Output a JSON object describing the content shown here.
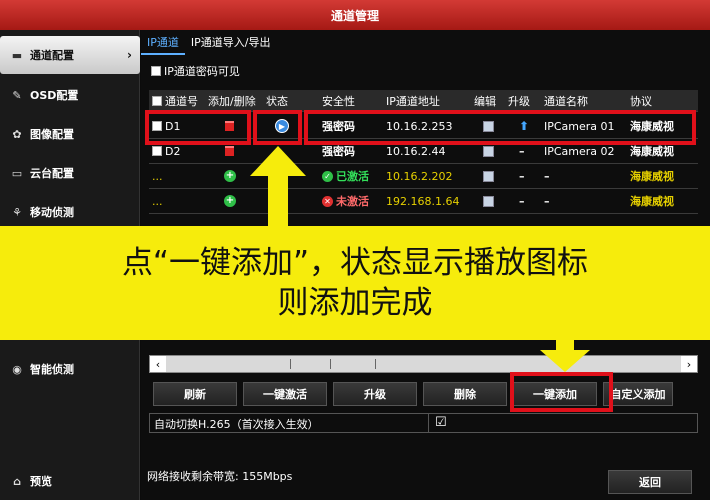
{
  "window": {
    "title": "通道管理"
  },
  "sidebar": {
    "items": [
      {
        "label": "通道配置",
        "icon": "camera-icon",
        "active": true
      },
      {
        "label": "OSD配置",
        "icon": "pen-icon"
      },
      {
        "label": "图像配置",
        "icon": "image-icon"
      },
      {
        "label": "云台配置",
        "icon": "ptz-icon"
      },
      {
        "label": "移动侦测",
        "icon": "motion-icon"
      },
      {
        "label": "智能侦测",
        "icon": "smart-icon"
      },
      {
        "label": "预览",
        "icon": "home-icon"
      }
    ]
  },
  "tabs": [
    {
      "label": "IP通道",
      "active": true
    },
    {
      "label": "IP通道导入/导出"
    }
  ],
  "password_visible": {
    "label": "IP通道密码可见"
  },
  "table": {
    "headers": [
      "通道号",
      "添加/删除",
      "状态",
      "安全性",
      "IP通道地址",
      "编辑",
      "升级",
      "通道名称",
      "协议"
    ],
    "rows": [
      {
        "channel": "D1",
        "action": "delete",
        "status": "play",
        "security": "强密码",
        "ip": "10.16.2.253",
        "edit": true,
        "upgrade": "up",
        "name": "IPCamera 01",
        "protocol": "海康威视"
      },
      {
        "channel": "D2",
        "action": "delete",
        "status": "",
        "security": "强密码",
        "ip": "10.16.2.44",
        "edit": true,
        "upgrade": "–",
        "name": "IPCamera 02",
        "protocol": "海康威视"
      },
      {
        "channel": "...",
        "action": "add",
        "status": "",
        "security": "已激活",
        "security_state": "ok",
        "ip": "10.16.2.202",
        "edit": true,
        "upgrade": "–",
        "name": "–",
        "protocol": "海康威视"
      },
      {
        "channel": "...",
        "action": "add",
        "status": "",
        "security": "未激活",
        "security_state": "bad",
        "ip": "192.168.1.64",
        "edit": true,
        "upgrade": "–",
        "name": "–",
        "protocol": "海康威视"
      }
    ]
  },
  "overlay": {
    "line1": "点“一键添加”，状态显示播放图标",
    "line2": "则添加完成"
  },
  "buttons": {
    "refresh": "刷新",
    "activate": "一键激活",
    "upgrade": "升级",
    "delete": "删除",
    "add_one_click": "一键添加",
    "custom_add": "自定义添加",
    "back": "返回"
  },
  "auto_switch": {
    "label": "自动切换H.265（首次接入生效）",
    "checked": true,
    "mark": "☑"
  },
  "bandwidth": {
    "label": "网络接收剩余带宽: 155Mbps"
  },
  "colors": {
    "title_red": "#c0221d",
    "highlight_red": "#e0101a",
    "overlay_yellow": "#f6ec0c",
    "link_blue": "#5eb0ff"
  }
}
